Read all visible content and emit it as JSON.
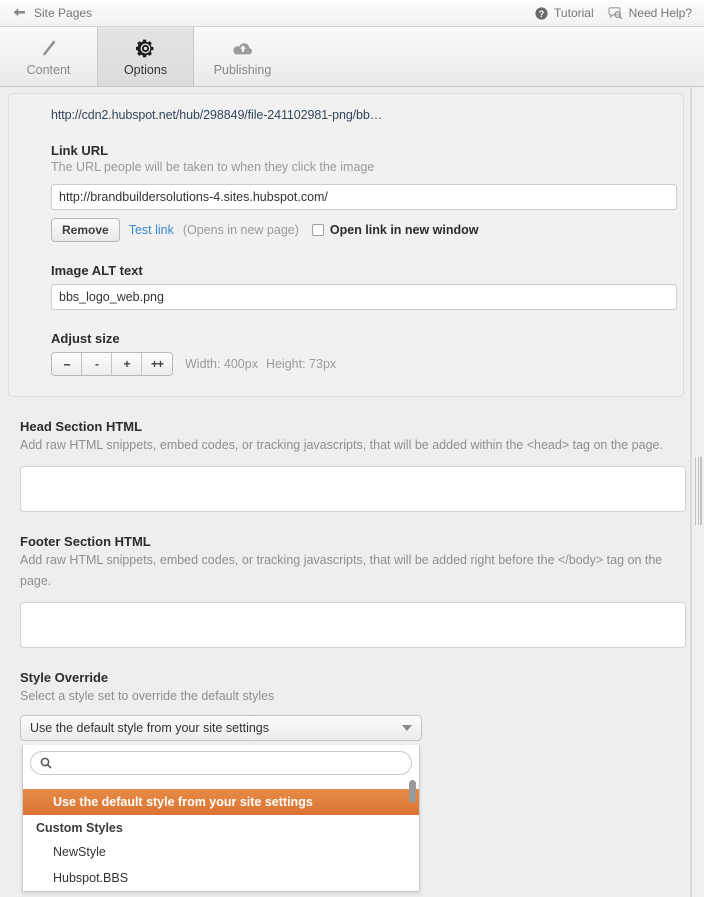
{
  "header": {
    "back_label": "Site Pages",
    "back_icon": "back-arrow-icon",
    "tutorial_label": "Tutorial",
    "tutorial_icon": "question-circle-icon",
    "help_label": "Need Help?",
    "help_icon": "speech-bubble-search-icon"
  },
  "tabs": [
    {
      "label": "Content",
      "icon": "pencil-icon",
      "active": false
    },
    {
      "label": "Options",
      "icon": "gear-icon",
      "active": true
    },
    {
      "label": "Publishing",
      "icon": "cloud-upload-icon",
      "active": false
    }
  ],
  "image_panel": {
    "file_url": "http://cdn2.hubspot.net/hub/298849/file-241102981-png/bb…",
    "link_url": {
      "label": "Link URL",
      "help": "The URL people will be taken to when they click the image",
      "value": "http://brandbuildersolutions-4.sites.hubspot.com/",
      "placeholder": ""
    },
    "actions": {
      "remove_label": "Remove",
      "test_link_label": "Test link",
      "test_link_note": "(Opens in new page)",
      "open_new_window_label": "Open link in new window",
      "open_new_window_checked": false
    },
    "alt_text": {
      "label": "Image ALT text",
      "value": "bbs_logo_web.png",
      "placeholder": ""
    },
    "adjust_size": {
      "label": "Adjust size",
      "buttons": [
        "--",
        "-",
        "+",
        "++"
      ],
      "width_label": "Width: 400px",
      "height_label": "Height: 73px"
    }
  },
  "head_section": {
    "title": "Head Section HTML",
    "description": "Add raw HTML snippets, embed codes, or tracking javascripts, that will be added within the <head> tag on the page.",
    "value": "",
    "placeholder": ""
  },
  "footer_section": {
    "title": "Footer Section HTML",
    "description": "Add raw HTML snippets, embed codes, or tracking javascripts, that will be added right before the </body> tag on the page.",
    "value": "",
    "placeholder": ""
  },
  "style_override": {
    "title": "Style Override",
    "description": "Select a style set to override the default styles",
    "selected": "Use the default style from your site settings",
    "caret_icon": "chevron-down-icon",
    "search": {
      "value": "",
      "placeholder": "",
      "icon": "search-icon"
    },
    "options": [
      {
        "label": "Use the default style from your site settings",
        "selected": true,
        "type": "option"
      },
      {
        "label": "Custom Styles",
        "type": "group"
      },
      {
        "label": "NewStyle",
        "selected": false,
        "type": "option"
      },
      {
        "label": "Hubspot.BBS",
        "selected": false,
        "type": "option"
      }
    ]
  },
  "colors": {
    "accent": "#dd7433",
    "link": "#3a87cd",
    "background": "#eeeeee",
    "muted_text": "#999999"
  }
}
